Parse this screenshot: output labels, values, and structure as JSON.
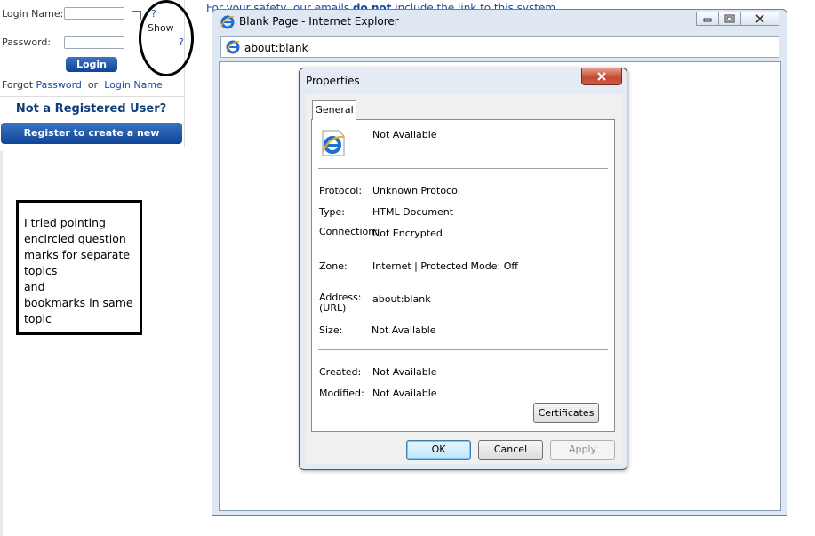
{
  "login": {
    "login_name_label": "Login Name:",
    "password_label": "Password:",
    "question_mark": "?",
    "show_label": "Show",
    "login_button": "Login",
    "forgot_prefix": "Forgot",
    "forgot_password_link": "Password",
    "forgot_or": "or",
    "forgot_login_link": "Login Name",
    "not_registered": "Not a Registered User?",
    "register_button": "Register to create a new account"
  },
  "annotation": {
    "lines": [
      "I tried pointing",
      "encircled question",
      "marks for separate",
      "topics",
      "and",
      "bookmarks in same",
      "topic"
    ]
  },
  "background_page": {
    "top_line_prefix": "For your safety, our emails ",
    "top_line_bold": "do not",
    "top_line_suffix": " include the link to this system"
  },
  "ie": {
    "title": "Blank Page - Internet Explorer",
    "address": "about:blank",
    "icon": "ie-icon",
    "window_buttons": [
      "minimize-icon",
      "restore-icon",
      "close-icon"
    ]
  },
  "properties": {
    "title": "Properties",
    "tab": "General",
    "page_title": "Not Available",
    "rows": {
      "protocol_label": "Protocol:",
      "protocol_value": "Unknown Protocol",
      "type_label": "Type:",
      "type_value": "HTML Document",
      "connection_label": "Connection:",
      "connection_value": "Not Encrypted",
      "zone_label": "Zone:",
      "zone_value": "Internet | Protected Mode: Off",
      "address_label_1": "Address:",
      "address_label_2": "(URL)",
      "address_value": "about:blank",
      "size_label": "Size:",
      "size_value": "Not Available",
      "created_label": "Created:",
      "created_value": "Not Available",
      "modified_label": "Modified:",
      "modified_value": "Not Available"
    },
    "certificates_button": "Certificates",
    "ok_button": "OK",
    "cancel_button": "Cancel",
    "apply_button": "Apply"
  },
  "colors": {
    "link": "#1a4c9a",
    "button_blue": "#0e4496",
    "close_red": "#c44a32"
  }
}
